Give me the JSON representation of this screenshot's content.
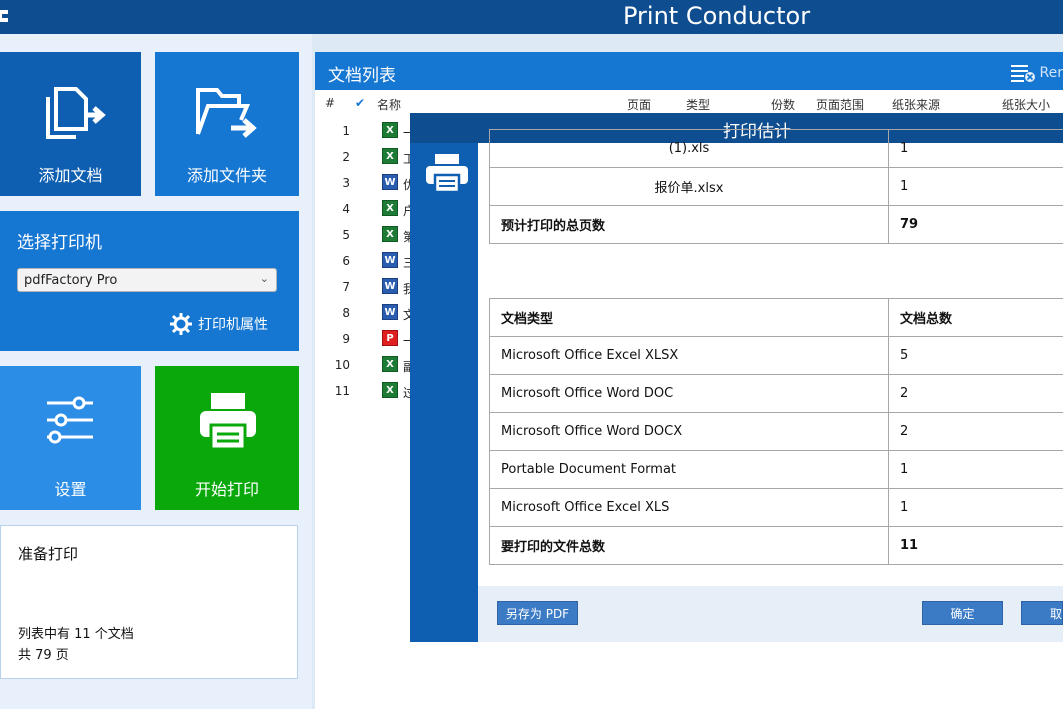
{
  "app": {
    "title": "Print Conductor"
  },
  "tiles": {
    "add_documents": "添加文档",
    "add_folder": "添加文件夹",
    "settings": "设置",
    "start_printing": "开始打印"
  },
  "printer": {
    "heading": "选择打印机",
    "selected": "pdfFactory Pro",
    "properties_label": "打印机属性"
  },
  "status": {
    "heading": "准备打印",
    "line1": "列表中有 11 个文档",
    "line2": "共 79 页"
  },
  "doclist": {
    "title": "文档列表",
    "remove_label": "Rer",
    "columns": [
      "#",
      "✔",
      "名称",
      "页面",
      "类型",
      "份数",
      "页面范围",
      "纸张来源",
      "纸张大小"
    ],
    "rows": [
      {
        "num": "1",
        "icon": "excel-icon",
        "name": "一"
      },
      {
        "num": "2",
        "icon": "excel-icon",
        "name": "工"
      },
      {
        "num": "3",
        "icon": "word-icon",
        "name": "优"
      },
      {
        "num": "4",
        "icon": "excel-icon",
        "name": "户"
      },
      {
        "num": "5",
        "icon": "excel-icon",
        "name": "第"
      },
      {
        "num": "6",
        "icon": "word-icon",
        "name": "三"
      },
      {
        "num": "7",
        "icon": "word-icon",
        "name": "我"
      },
      {
        "num": "8",
        "icon": "word-icon",
        "name": "文"
      },
      {
        "num": "9",
        "icon": "pdf-icon",
        "name": "一"
      },
      {
        "num": "10",
        "icon": "excel-icon",
        "name": "副"
      },
      {
        "num": "11",
        "icon": "excel-icon",
        "name": "过"
      }
    ]
  },
  "dialog": {
    "title": "打印估计",
    "top_table": [
      {
        "name": "(1).xls",
        "pages": "1"
      },
      {
        "name": "报价单.xlsx",
        "pages": "1"
      },
      {
        "name": "预计打印的总页数",
        "pages": "79"
      }
    ],
    "type_table": {
      "header_type": "文档类型",
      "header_count": "文档总数",
      "rows": [
        {
          "type": "Microsoft Office Excel XLSX",
          "count": "5"
        },
        {
          "type": "Microsoft Office Word DOC",
          "count": "2"
        },
        {
          "type": "Microsoft Office Word DOCX",
          "count": "2"
        },
        {
          "type": "Portable Document Format",
          "count": "1"
        },
        {
          "type": "Microsoft Office Excel XLS",
          "count": "1"
        }
      ],
      "total_label": "要打印的文件总数",
      "total_count": "11"
    },
    "save_pdf": "另存为 PDF",
    "ok": "确定",
    "cancel": "取"
  }
}
